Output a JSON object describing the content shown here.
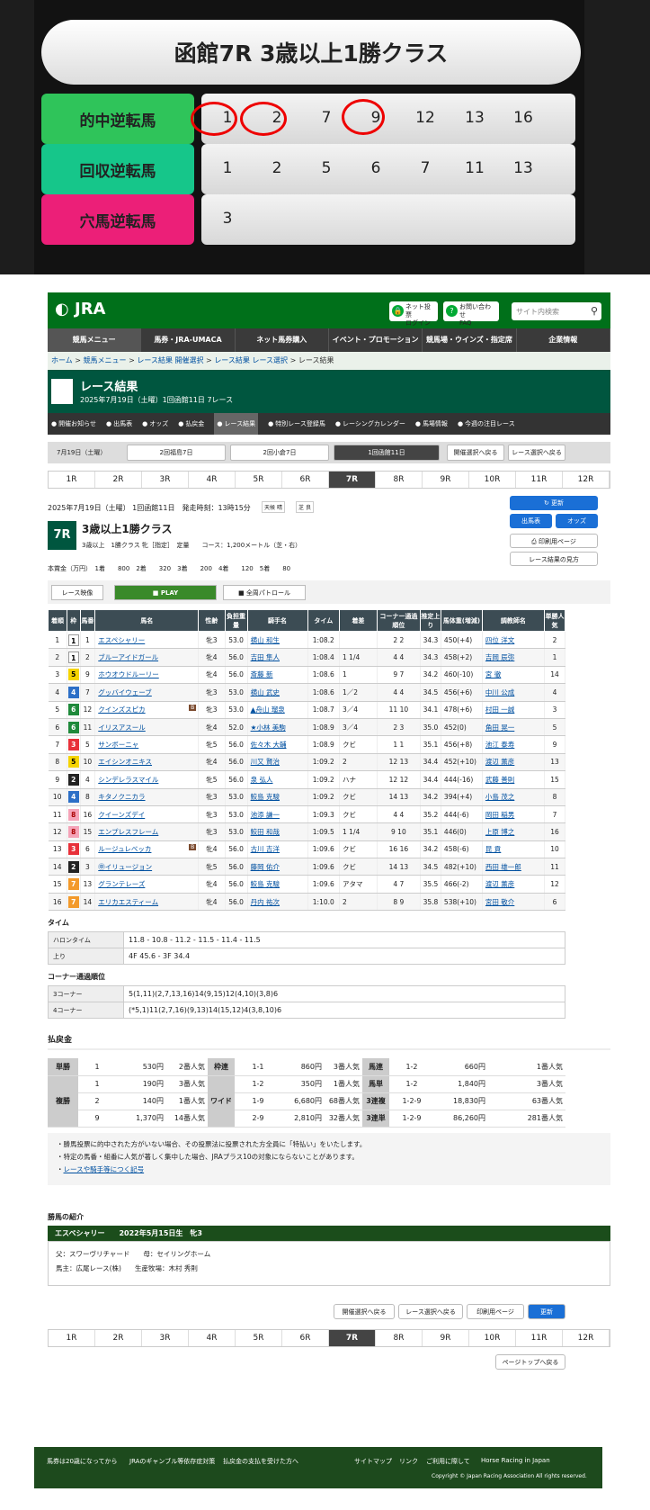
{
  "prediction": {
    "title": "函館7R 3歳以上1勝クラス",
    "rows": [
      {
        "label": "的中逆転馬",
        "color": "#2fc45a",
        "nums": [
          "1",
          "2",
          "7",
          "9",
          "12",
          "13",
          "16"
        ]
      },
      {
        "label": "回収逆転馬",
        "color": "#16c68a",
        "nums": [
          "1",
          "2",
          "5",
          "6",
          "7",
          "11",
          "13"
        ]
      },
      {
        "label": "穴馬逆転馬",
        "color": "#ec1f78",
        "nums": [
          "3"
        ]
      }
    ]
  },
  "header": {
    "logo": "JRA",
    "login1": "ネット投票",
    "login2": "ログイン",
    "faq1": "お問い合わせ",
    "faq2": "FAQ",
    "search_placeholder": "サイト内検索"
  },
  "gnav": [
    "競馬メニュー",
    "馬券・JRA-UMACA",
    "ネット馬券購入",
    "イベント・プロモーション",
    "競馬場・ウインズ・指定席",
    "企業情報"
  ],
  "breadcrumb": [
    "ホーム",
    "競馬メニュー",
    "レース結果 開催選択",
    "レース結果 レース選択",
    "レース結果"
  ],
  "race_header": {
    "title": "レース結果",
    "subtitle": "2025年7月19日（土曜）1回函館11日 7レース"
  },
  "subnav": [
    "開催お知らせ",
    "出馬表",
    "オッズ",
    "払戻金",
    "レース結果",
    "特別レース登録馬",
    "レーシングカレンダー",
    "馬場情報",
    "今週の注目レース"
  ],
  "datebar": {
    "date": "7月19日（土曜）",
    "v1": "2回福島7日",
    "v2": "2回小倉7日",
    "v3": "1回函館11日",
    "b1": "開催選択へ戻る",
    "b2": "レース選択へ戻る"
  },
  "race_tabs": [
    "1R",
    "2R",
    "3R",
    "4R",
    "5R",
    "6R",
    "7R",
    "8R",
    "9R",
    "10R",
    "11R",
    "12R"
  ],
  "race_info": {
    "date_line": "2025年7月19日（土曜） 1回函館11日　発走時刻：13時15分",
    "weather_label": "天候",
    "weather": "晴",
    "turf_label": "芝",
    "turf": "良",
    "race_no": "7R",
    "race_name": "3歳以上1勝クラス",
    "detail": "3歳以上　1勝クラス 牝［指定］　定量　　コース：1,200メートル（芝・右）",
    "prize": "本賞金（万円）　1着　　800　2着　　320　3着　　200　4着　　120　5着　　80",
    "btn_update": "更新",
    "btn_entry": "出馬表",
    "btn_odds": "オッズ",
    "btn_print": "印刷用ページ",
    "btn_help": "レース結果の見方"
  },
  "video": {
    "label": "レース映像",
    "play": "PLAY",
    "patrol": "全周パトロール"
  },
  "result_headers": [
    "着順",
    "枠",
    "馬番",
    "馬名",
    "性齢",
    "負担重量",
    "騎手名",
    "タイム",
    "着差",
    "コーナー通過順位",
    "推定上り",
    "馬体重(増減)",
    "調教師名",
    "単勝人気"
  ],
  "results": [
    [
      "1",
      "1",
      "1",
      "エスペシャリー",
      "牝3",
      "53.0",
      "横山 和生",
      "1:08.2",
      "",
      "2 2",
      "34.3",
      "450(+4)",
      "四位 洋文",
      "2"
    ],
    [
      "2",
      "1",
      "2",
      "ブルーアイドガール",
      "牝4",
      "56.0",
      "吉田 隼人",
      "1:08.4",
      "1 1/4",
      "4 4",
      "34.3",
      "458(+2)",
      "吉岡 辰弥",
      "1"
    ],
    [
      "3",
      "5",
      "9",
      "ホウオウドルーリー",
      "牝4",
      "56.0",
      "斎藤 新",
      "1:08.6",
      "1",
      "9 7",
      "34.2",
      "460(-10)",
      "宮 徹",
      "14"
    ],
    [
      "4",
      "4",
      "7",
      "グッバイウェーブ",
      "牝3",
      "53.0",
      "横山 武史",
      "1:08.6",
      "1／2",
      "4 4",
      "34.5",
      "456(+6)",
      "中川 公成",
      "4"
    ],
    [
      "5",
      "6",
      "12",
      "クインズスピカ",
      "牝3",
      "53.0",
      "▲舟山 瑠泉",
      "1:08.7",
      "3／4",
      "11 10",
      "34.1",
      "478(+6)",
      "村田 一誠",
      "3"
    ],
    [
      "6",
      "6",
      "11",
      "イリスアスール",
      "牝4",
      "52.0",
      "★小林 美駒",
      "1:08.9",
      "3／4",
      "2 3",
      "35.0",
      "452(0)",
      "角田 晃一",
      "5"
    ],
    [
      "7",
      "3",
      "5",
      "サンボーニャ",
      "牝5",
      "56.0",
      "佐々木 大輔",
      "1:08.9",
      "クビ",
      "1 1",
      "35.1",
      "456(+8)",
      "池江 泰寿",
      "9"
    ],
    [
      "8",
      "5",
      "10",
      "エイシンオニキス",
      "牝4",
      "56.0",
      "川又 賢治",
      "1:09.2",
      "2",
      "12 13",
      "34.4",
      "452(+10)",
      "渡辺 薫彦",
      "13"
    ],
    [
      "9",
      "2",
      "4",
      "シンデレラスマイル",
      "牝5",
      "56.0",
      "泉 弘人",
      "1:09.2",
      "ハナ",
      "12 12",
      "34.4",
      "444(-16)",
      "武藤 善則",
      "15"
    ],
    [
      "10",
      "4",
      "8",
      "キタノクニカラ",
      "牝3",
      "53.0",
      "鮫島 克駿",
      "1:09.2",
      "クビ",
      "14 13",
      "34.2",
      "394(+4)",
      "小島 茂之",
      "8"
    ],
    [
      "11",
      "8",
      "16",
      "クイーンズデイ",
      "牝3",
      "53.0",
      "池添 謙一",
      "1:09.3",
      "クビ",
      "4 4",
      "35.2",
      "444(-6)",
      "岡田 稲男",
      "7"
    ],
    [
      "12",
      "8",
      "15",
      "エンプレスフレーム",
      "牝3",
      "53.0",
      "鮫田 和哉",
      "1:09.5",
      "1 1/4",
      "9 10",
      "35.1",
      "446(0)",
      "上原 博之",
      "16"
    ],
    [
      "13",
      "3",
      "6",
      "ルージュレベッカ",
      "牝4",
      "56.0",
      "古川 吉洋",
      "1:09.6",
      "クビ",
      "16 16",
      "34.2",
      "458(-6)",
      "昆 貢",
      "10"
    ],
    [
      "14",
      "2",
      "3",
      "㊥イリュージョン",
      "牝5",
      "56.0",
      "藤岡 佑介",
      "1:09.6",
      "クビ",
      "14 13",
      "34.5",
      "482(+10)",
      "西田 雄一郎",
      "11"
    ],
    [
      "15",
      "7",
      "13",
      "グランテレーズ",
      "牝4",
      "56.0",
      "鮫島 克駿",
      "1:09.6",
      "アタマ",
      "4 7",
      "35.5",
      "466(-2)",
      "渡辺 薫彦",
      "12"
    ],
    [
      "16",
      "7",
      "14",
      "エリカエスティーム",
      "牝4",
      "56.0",
      "丹内 祐次",
      "1:10.0",
      "2",
      "8 9",
      "35.8",
      "538(+10)",
      "宮田 敬介",
      "6"
    ]
  ],
  "b_marks": [
    "クインズスピカ",
    "ルージュレベッカ"
  ],
  "time_section": {
    "title": "タイム",
    "rows": [
      [
        "ハロンタイム",
        "11.8 - 10.8 - 11.2 - 11.5 - 11.4 - 11.5"
      ],
      [
        "上り",
        "4F 45.6 - 3F 34.4"
      ]
    ]
  },
  "corner_section": {
    "title": "コーナー通過順位",
    "rows": [
      [
        "3コーナー",
        "5(1,11)(2,7,13,16)14(9,15)12(4,10)(3,8)6"
      ],
      [
        "4コーナー",
        "(*5,1)11(2,7,16)(9,13)14(15,12)4(3,8,10)6"
      ]
    ]
  },
  "payout_title": "払戻金",
  "payouts": {
    "tansho": {
      "label": "単勝",
      "rows": [
        [
          "1",
          "530円",
          "2番人気"
        ]
      ]
    },
    "fukusho": {
      "label": "複勝",
      "rows": [
        [
          "1",
          "190円",
          "3番人気"
        ],
        [
          "2",
          "140円",
          "1番人気"
        ],
        [
          "9",
          "1,370円",
          "14番人気"
        ]
      ]
    },
    "wakuren": {
      "label": "枠連",
      "rows": [
        [
          "1-1",
          "860円",
          "3番人気"
        ]
      ]
    },
    "wide": {
      "label": "ワイド",
      "rows": [
        [
          "1-2",
          "350円",
          "1番人気"
        ],
        [
          "1-9",
          "6,680円",
          "68番人気"
        ],
        [
          "2-9",
          "2,810円",
          "32番人気"
        ]
      ]
    },
    "umaren": {
      "label": "馬連",
      "rows": [
        [
          "1-2",
          "660円",
          "1番人気"
        ]
      ]
    },
    "umatan": {
      "label": "馬単",
      "rows": [
        [
          "1-2",
          "1,840円",
          "3番人気"
        ]
      ]
    },
    "sanrenpuku": {
      "label": "3連複",
      "rows": [
        [
          "1-2-9",
          "18,830円",
          "63番人気"
        ]
      ]
    },
    "sanrentan": {
      "label": "3連単",
      "rows": [
        [
          "1-2-9",
          "86,260円",
          "281番人気"
        ]
      ]
    }
  },
  "notes": [
    "勝馬投票に的中された方がいない場合、その投票法に投票された方全員に「特払い」をいたします。",
    "特定の馬番・組番に人気が著しく集中した場合、JRAプラス10の対象にならないことがあります。",
    "レースや騎手等につく記号"
  ],
  "intro": {
    "title": "勝馬の紹介",
    "bar": "エスペシャリー　　2022年5月15日生　牝3",
    "line1": "父：スワーヴリチャード　　母：セイリングホーム",
    "line2": "馬主：広尾レース(株)　　生産牧場：木村 秀則"
  },
  "bottom_buttons": {
    "b1": "開催選択へ戻る",
    "b2": "レース選択へ戻る",
    "b3": "印刷用ページ",
    "b4": "更新",
    "top": "ページトップへ戻る"
  },
  "footer": {
    "links": [
      "馬券は20歳になってから",
      "JRAのギャンブル等依存症対策",
      "払戻金の支払を受けた方へ",
      "サイトマップ",
      "リンク",
      "ご利用に際して",
      "Horse Racing in Japan"
    ],
    "copyright": "Copyright © Japan Racing Association All rights reserved."
  },
  "colors": {
    "jra_green": "#00701a",
    "waku": [
      "#ffffff",
      "#222222",
      "#e8313a",
      "#2c6fc7",
      "#f5d400",
      "#1f8a3b",
      "#f39a2b",
      "#f5a3b8"
    ]
  }
}
